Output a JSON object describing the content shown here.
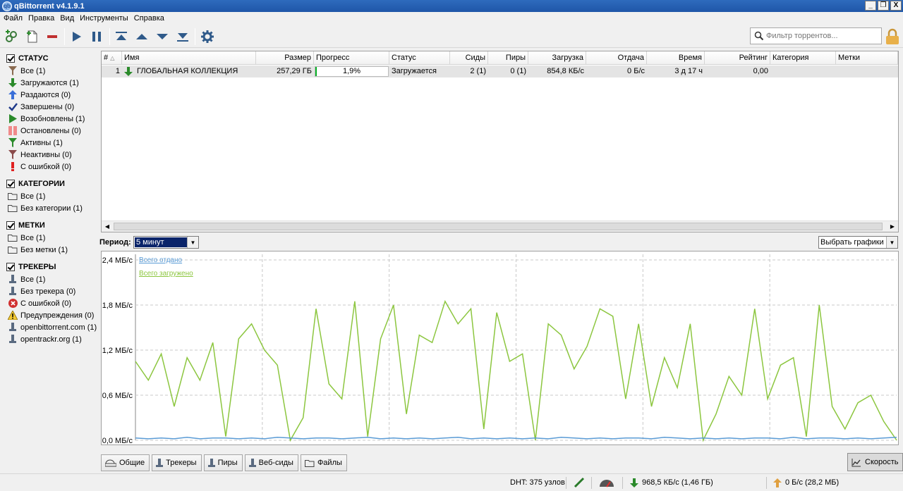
{
  "window": {
    "title": "qBittorrent v4.1.9.1",
    "controls": [
      "_",
      "❐",
      "X"
    ]
  },
  "menu": [
    "Файл",
    "Правка",
    "Вид",
    "Инструменты",
    "Справка"
  ],
  "search": {
    "placeholder": "Фильтр торрентов..."
  },
  "sidebar": {
    "status": {
      "header": "СТАТУС",
      "items": [
        {
          "label": "Все (1)",
          "icon": "funnel-icon"
        },
        {
          "label": "Загружаются (1)",
          "icon": "download-arrow-icon"
        },
        {
          "label": "Раздаются (0)",
          "icon": "upload-arrow-icon"
        },
        {
          "label": "Завершены (0)",
          "icon": "checkmark-icon"
        },
        {
          "label": "Возобновлены (1)",
          "icon": "play-icon"
        },
        {
          "label": "Остановлены (0)",
          "icon": "pause-icon"
        },
        {
          "label": "Активны (1)",
          "icon": "funnel-icon"
        },
        {
          "label": "Неактивны (0)",
          "icon": "funnel-icon"
        },
        {
          "label": "С ошибкой (0)",
          "icon": "exclamation-icon"
        }
      ]
    },
    "categories": {
      "header": "КАТЕГОРИИ",
      "items": [
        {
          "label": "Все (1)"
        },
        {
          "label": "Без категории (1)"
        }
      ]
    },
    "tags": {
      "header": "МЕТКИ",
      "items": [
        {
          "label": "Все (1)"
        },
        {
          "label": "Без метки (1)"
        }
      ]
    },
    "trackers": {
      "header": "ТРЕКЕРЫ",
      "items": [
        {
          "label": "Все (1)",
          "icon": "tracker-icon"
        },
        {
          "label": "Без трекера (0)",
          "icon": "tracker-icon"
        },
        {
          "label": "С ошибкой (0)",
          "icon": "error-icon"
        },
        {
          "label": "Предупреждения (0)",
          "icon": "warning-icon"
        },
        {
          "label": "openbittorrent.com (1)",
          "icon": "tracker-icon"
        },
        {
          "label": "opentrackr.org (1)",
          "icon": "tracker-icon"
        }
      ]
    }
  },
  "table": {
    "columns": [
      "#",
      "Имя",
      "Размер",
      "Прогресс",
      "Статус",
      "Сиды",
      "Пиры",
      "Загрузка",
      "Отдача",
      "Время",
      "Рейтинг",
      "Категория",
      "Метки"
    ],
    "rows": [
      {
        "num": "1",
        "name": "ГЛОБАЛЬНАЯ КОЛЛЕКЦИЯ",
        "size": "257,29 ГБ",
        "progress": "1,9%",
        "progress_value": 0.019,
        "status": "Загружается",
        "seeds": "2 (1)",
        "peers": "0 (1)",
        "down": "854,8 КБ/с",
        "up": "0 Б/с",
        "eta": "3 д 17 ч",
        "ratio": "0,00",
        "category": "",
        "tags": ""
      }
    ]
  },
  "period": {
    "label": "Период:",
    "value": "5 минут"
  },
  "graphs_select": {
    "value": "Выбрать графики"
  },
  "chart_data": {
    "type": "line",
    "y_ticks": [
      "2,4 МБ/с",
      "1,8 МБ/с",
      "1,2 МБ/с",
      "0,6 МБ/с",
      "0,0 МБ/с"
    ],
    "ylim": [
      0,
      2.4
    ],
    "unit": "МБ/с",
    "grid": true,
    "legend_position": "top-left",
    "series": [
      {
        "name": "Всего отдано",
        "color": "#5a9bd5",
        "values": [
          0.03,
          0.02,
          0.03,
          0.02,
          0.04,
          0.02,
          0.03,
          0.03,
          0.02,
          0.03,
          0.02,
          0.04,
          0.03,
          0.02,
          0.03,
          0.03,
          0.02,
          0.03,
          0.04,
          0.02,
          0.03,
          0.02,
          0.03,
          0.02,
          0.03,
          0.04,
          0.02,
          0.03,
          0.02,
          0.03,
          0.02,
          0.03,
          0.02,
          0.04,
          0.03,
          0.02,
          0.03,
          0.02,
          0.03,
          0.03,
          0.02,
          0.04,
          0.03,
          0.02,
          0.03,
          0.02,
          0.03,
          0.02,
          0.03,
          0.03,
          0.02,
          0.04,
          0.02,
          0.03,
          0.03,
          0.02,
          0.03,
          0.02,
          0.03,
          0.04
        ]
      },
      {
        "name": "Всего загружено",
        "color": "#8cc63f",
        "values": [
          1.05,
          0.8,
          1.15,
          0.45,
          1.1,
          0.8,
          1.3,
          0.05,
          1.35,
          1.55,
          1.2,
          1.0,
          0.0,
          0.3,
          1.75,
          0.75,
          0.55,
          1.85,
          0.05,
          1.35,
          1.8,
          0.35,
          1.4,
          1.3,
          1.85,
          1.55,
          1.75,
          0.15,
          1.7,
          1.05,
          1.15,
          0.0,
          1.55,
          1.4,
          0.95,
          1.25,
          1.75,
          1.65,
          0.55,
          1.55,
          0.45,
          1.1,
          0.7,
          1.55,
          0.0,
          0.35,
          0.85,
          0.6,
          1.75,
          0.55,
          1.0,
          1.1,
          0.05,
          1.8,
          0.45,
          0.15,
          0.5,
          0.6,
          0.25,
          0.0
        ]
      }
    ]
  },
  "bottom_tabs": [
    "Общие",
    "Трекеры",
    "Пиры",
    "Веб-сиды",
    "Файлы"
  ],
  "speed_tab": "Скорость",
  "statusbar": {
    "dht": "DHT: 375 узлов",
    "download": "968,5 КБ/с (1,46 ГБ)",
    "upload": "0 Б/с (28,2 МБ)"
  }
}
